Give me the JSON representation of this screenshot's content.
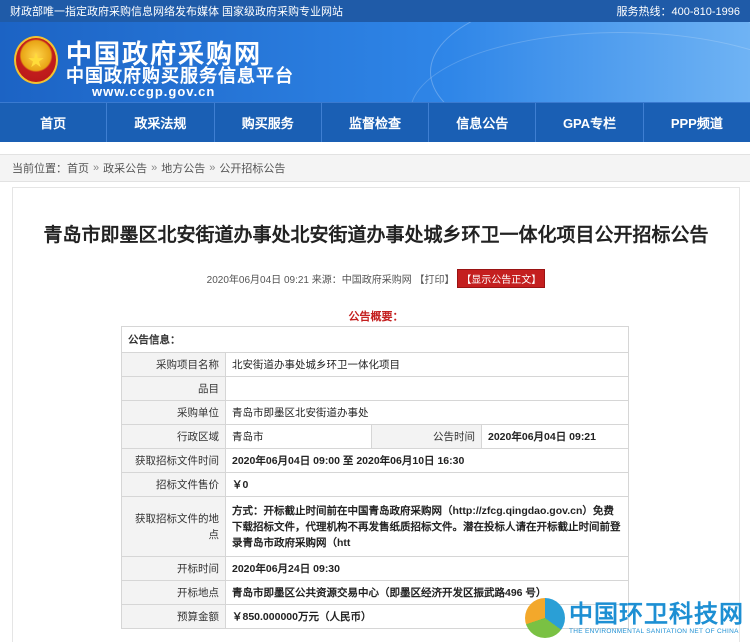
{
  "topbar": {
    "left_text": "财政部唯一指定政府采购信息网络发布媒体 国家级政府采购专业网站",
    "hotline": "服务热线：400-810-1996"
  },
  "banner": {
    "title": "中国政府采购网",
    "subtitle": "中国政府购买服务信息平台",
    "url": "www.ccgp.gov.cn"
  },
  "nav": {
    "items": [
      "首页",
      "政采法规",
      "购买服务",
      "监督检查",
      "信息公告",
      "GPA专栏",
      "PPP频道"
    ]
  },
  "breadcrumb": {
    "prefix": "当前位置：",
    "items": [
      "首页",
      "政采公告",
      "地方公告",
      "公开招标公告"
    ],
    "sep": "»"
  },
  "article": {
    "title": "青岛市即墨区北安街道办事处北安街道办事处城乡环卫一体化项目公开招标公告",
    "meta": "2020年06月04日 09:21 来源：中国政府采购网 【打印】",
    "show_body_button": "【显示公告正文】",
    "summary_label": "公告概要："
  },
  "info_table": {
    "header": "公告信息：",
    "rows": {
      "project_name_label": "采购项目名称",
      "project_name": "北安街道办事处城乡环卫一体化项目",
      "item_label": "品目",
      "item": "",
      "unit_label": "采购单位",
      "unit": "青岛市即墨区北安街道办事处",
      "region_label": "行政区域",
      "region": "青岛市",
      "pub_time_label": "公告时间",
      "pub_time": "2020年06月04日 09:21",
      "doc_time_label": "获取招标文件时间",
      "doc_time": "2020年06月04日 09:00 至 2020年06月10日 16:30",
      "price_label": "招标文件售价",
      "price": "￥0",
      "doc_place_label": "获取招标文件的地点",
      "doc_place": "方式：开标截止时间前在中国青岛政府采购网（http://zfcg.qingdao.gov.cn）免费下载招标文件，代理机构不再发售纸质招标文件。潜在投标人请在开标截止时间前登录青岛市政府采购网（htt",
      "open_time_label": "开标时间",
      "open_time": "2020年06月24日 09:30",
      "open_place_label": "开标地点",
      "open_place": "青岛市即墨区公共资源交易中心（即墨区经济开发区振武路496 号）",
      "budget_label": "预算金额",
      "budget": "￥850.000000万元（人民币）"
    }
  },
  "watermark": {
    "title": "中国环卫科技网",
    "subtitle": "THE ENVIRONMENTAL SANITATION NET OF CHINA"
  }
}
